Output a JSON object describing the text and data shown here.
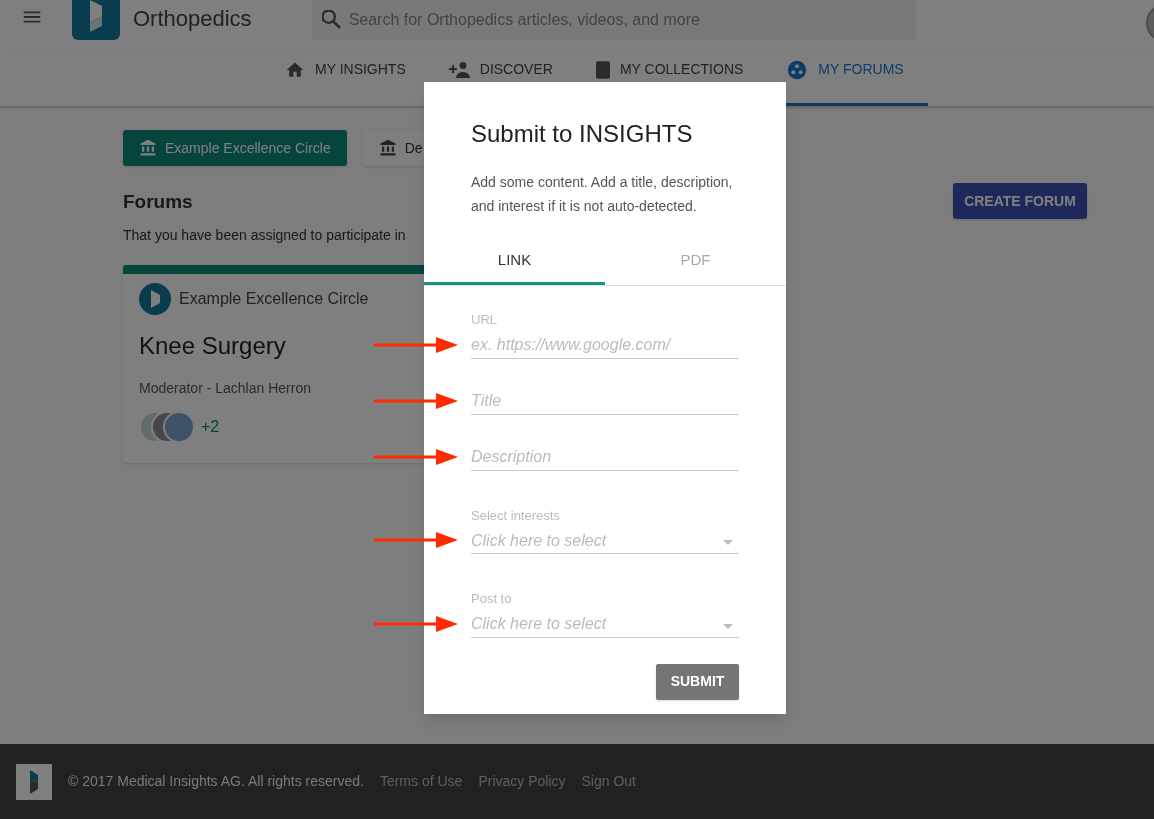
{
  "header": {
    "app_name": "Orthopedics",
    "search": {
      "placeholder": "Search for Orthopedics articles, videos, and more"
    }
  },
  "nav_tabs": [
    {
      "label": "MY INSIGHTS",
      "selected": false
    },
    {
      "label": "DISCOVER",
      "selected": false
    },
    {
      "label": "MY COLLECTIONS",
      "selected": false
    },
    {
      "label": "MY FORUMS",
      "selected": true
    }
  ],
  "circle_buttons": [
    {
      "label": "Example Excellence Circle",
      "selected": true
    },
    {
      "label": "De",
      "selected": false
    }
  ],
  "forums": {
    "title": "Forums",
    "subtitle": "That you have been assigned to participate in",
    "create_button": "CREATE FORUM",
    "cards": [
      {
        "circle": "Example Excellence Circle",
        "title": "Knee Surgery",
        "moderator": "Moderator - Lachlan Herron",
        "extra_members": "+2"
      }
    ]
  },
  "dialog": {
    "title": "Submit to INSIGHTS",
    "description": "Add some content. Add a title, description, and interest if it is not auto-detected.",
    "tabs": [
      {
        "label": "LINK",
        "selected": true
      },
      {
        "label": "PDF",
        "selected": false
      }
    ],
    "fields": [
      {
        "kind": "text",
        "label": "URL",
        "placeholder": "ex. https://www.google.com/"
      },
      {
        "kind": "text",
        "placeholder": "Title"
      },
      {
        "kind": "text",
        "placeholder": "Description"
      },
      {
        "kind": "select",
        "label": "Select interests",
        "placeholder": "Click here to select"
      },
      {
        "kind": "select",
        "label": "Post to",
        "placeholder": "Click here to select"
      }
    ],
    "submit": "SUBMIT"
  },
  "footer": {
    "copyright": "© 2017 Medical Insights AG. All rights reserved.",
    "links": [
      "Terms of Use",
      "Privacy Policy",
      "Sign Out"
    ]
  }
}
